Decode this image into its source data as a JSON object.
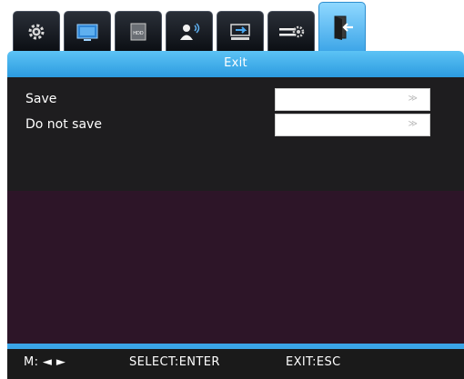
{
  "tabs": [
    {
      "icon": "gear-icon"
    },
    {
      "icon": "monitor-icon"
    },
    {
      "icon": "hdd-icon",
      "label": "HDD"
    },
    {
      "icon": "user-audio-icon"
    },
    {
      "icon": "network-icon"
    },
    {
      "icon": "settings-slider-icon"
    },
    {
      "icon": "exit-door-icon",
      "active": true
    }
  ],
  "header": {
    "title": "Exit"
  },
  "options": [
    {
      "label": "Save",
      "arrow": "≫"
    },
    {
      "label": "Do not save",
      "arrow": "≫"
    }
  ],
  "footer": {
    "menu_hint": "M: ◄ ►",
    "select_hint": "SELECT:ENTER",
    "exit_hint": "EXIT:ESC"
  },
  "colors": {
    "accent": "#3aa5e8",
    "panel_top": "#1e1d1f",
    "panel_bottom": "#2d1528",
    "footer": "#1a1a1a"
  }
}
